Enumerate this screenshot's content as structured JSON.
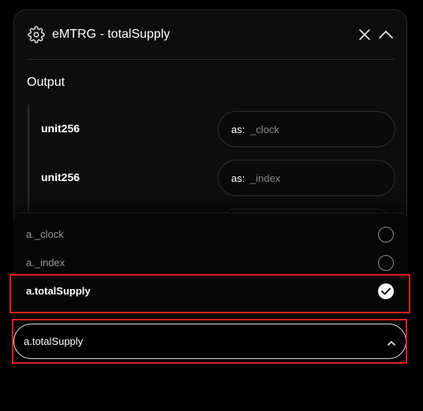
{
  "panel": {
    "title": "eMTRG - totalSupply",
    "icons": {
      "settings": "gear-icon",
      "close": "close-icon",
      "collapse": "chevron-up-icon"
    }
  },
  "output": {
    "section_title": "Output",
    "rows": [
      {
        "type": "unit256",
        "as_prefix": "as:",
        "as_value": "_clock"
      },
      {
        "type": "unit256",
        "as_prefix": "as:",
        "as_value": "_index"
      }
    ]
  },
  "dropdown": {
    "options": [
      {
        "label": "a._clock",
        "selected": false
      },
      {
        "label": "a._index",
        "selected": false
      },
      {
        "label": "a.totalSupply",
        "selected": true
      }
    ],
    "selected_value": "a.totalSupply",
    "chevron_icon": "chevron-up-icon"
  },
  "colors": {
    "background": "#000000",
    "panel": "#0d0d0d",
    "highlight": "#e0201e",
    "muted_text": "#8a8a8a"
  }
}
